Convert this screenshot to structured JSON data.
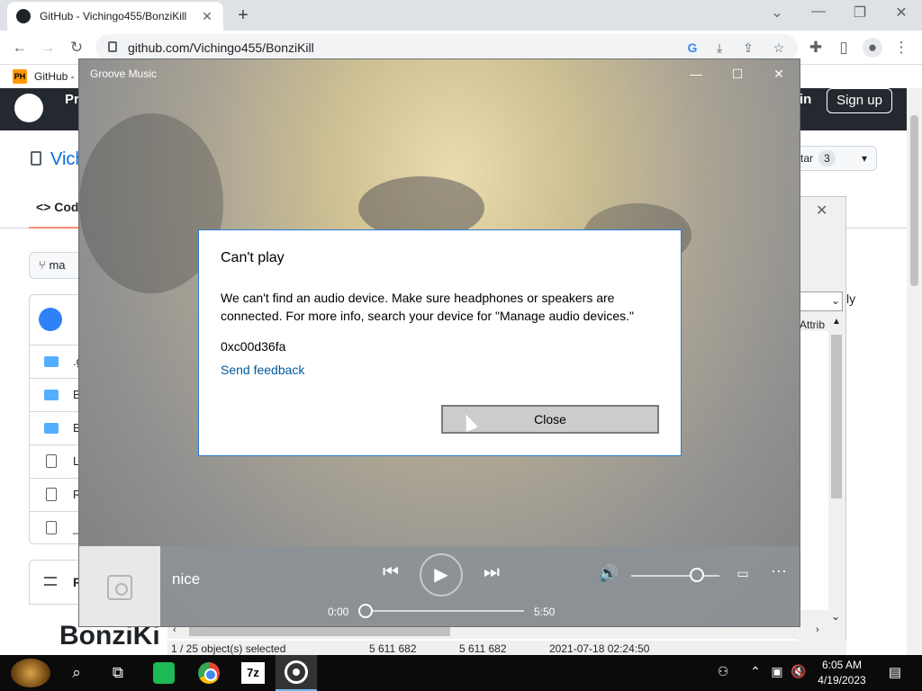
{
  "browser": {
    "tab_title": "GitHub - Vichingo455/BonziKill",
    "url": "github.com/Vichingo455/BonziKill",
    "bookmark_badge": "PH",
    "bookmark_label": "GitHub -"
  },
  "github": {
    "header_nav_partial": "Pr",
    "sign_in_partial": "in",
    "sign_up": "Sign up",
    "repo_owner_partial": "Vich",
    "star_label_partial": "tar",
    "star_count": "3",
    "code_tab_partial": "Cod",
    "branch_partial": "ma",
    "readme_heading_partial": "R",
    "readme_title_partial": "BonziKi",
    "file_rows_partial": [
      ".g",
      "B",
      "B",
      "L",
      "R",
      "_"
    ]
  },
  "zip_window": {
    "ghost_text": "ly",
    "column_header_partial": "Attrib",
    "status": {
      "selection": "1 / 25 object(s) selected",
      "size1": "5 611 682",
      "size2": "5 611 682",
      "modified": "2021-07-18 02:24:50"
    }
  },
  "groove": {
    "window_title": "Groove Music",
    "dialog": {
      "title": "Can't play",
      "message": "We can't find an audio device. Make sure headphones or speakers are connected. For more info, search your device for \"Manage audio devices.\"",
      "error_code": "0xc00d36fa",
      "feedback_link": "Send feedback",
      "close_button": "Close"
    },
    "player": {
      "track_title": "nice",
      "elapsed": "0:00",
      "duration": "5:50",
      "progress": 0.0,
      "volume_level": 0.7
    }
  },
  "taskbar": {
    "time": "6:05 AM",
    "date": "4/19/2023",
    "seven_zip_label": "7z"
  },
  "icons": {
    "chrome_window_controls": [
      "chevron-down-icon",
      "minimize-icon",
      "restore-icon",
      "close-icon"
    ],
    "groove_window_controls": [
      "minimize-icon",
      "maximize-icon",
      "close-icon"
    ]
  }
}
